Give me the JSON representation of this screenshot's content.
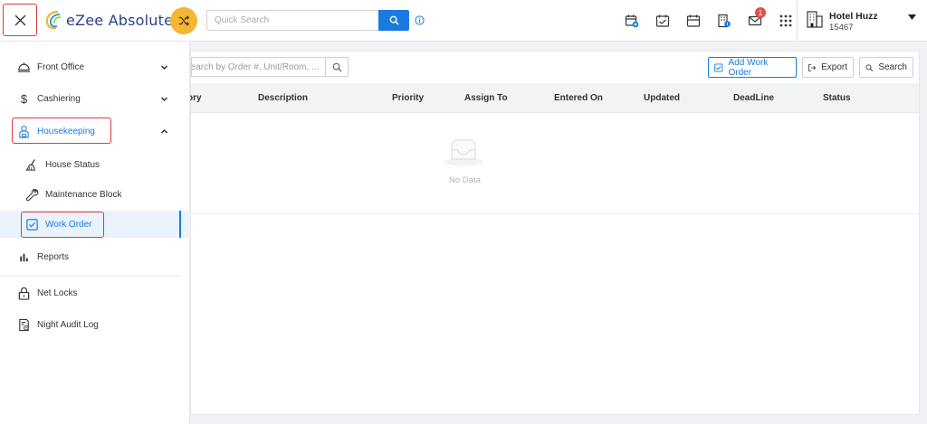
{
  "app": {
    "logo_text": "eZee Absolute",
    "colors": {
      "brand": "#2a3f8f",
      "accent": "#1a7ae0",
      "shuffle": "#f5b731",
      "highlight": "#e0393e",
      "badge": "#e84b4b"
    }
  },
  "header": {
    "close_icon": "close-icon",
    "shuffle_icon": "shuffle-icon",
    "quick_search_placeholder": "Quick Search",
    "notification_count": "1",
    "icons": [
      "calendar-add-icon",
      "calendar-check-icon",
      "calendar-icon",
      "building-badge-icon",
      "mail-icon",
      "grid-apps-icon"
    ]
  },
  "hotel": {
    "name": "Hotel Huzz",
    "code": "15467"
  },
  "sidebar": {
    "items": [
      {
        "label": "Front Office",
        "icon": "bell-tray-icon",
        "expandable": true
      },
      {
        "label": "Cashiering",
        "icon": "dollar-icon",
        "expandable": true
      },
      {
        "label": "Housekeeping",
        "icon": "housekeeper-icon",
        "expanded": true
      },
      {
        "label": "House Status",
        "icon": "broom-icon"
      },
      {
        "label": "Maintenance Block",
        "icon": "wrench-icon"
      },
      {
        "label": "Work Order",
        "icon": "checkbox-icon",
        "active": true
      },
      {
        "label": "Reports",
        "icon": "bar-chart-icon"
      },
      {
        "label": "Net Locks",
        "icon": "lock-icon"
      },
      {
        "label": "Night Audit Log",
        "icon": "log-icon"
      }
    ]
  },
  "main": {
    "search_placeholder": "Search by Order #, Unit/Room, ...",
    "buttons": {
      "add_work_order": "Add Work Order",
      "export": "Export",
      "search": "Search"
    },
    "columns": [
      "ory",
      "Description",
      "Priority",
      "Assign To",
      "Entered On",
      "Updated",
      "DeadLine",
      "Status"
    ],
    "empty_text": "No Data"
  }
}
